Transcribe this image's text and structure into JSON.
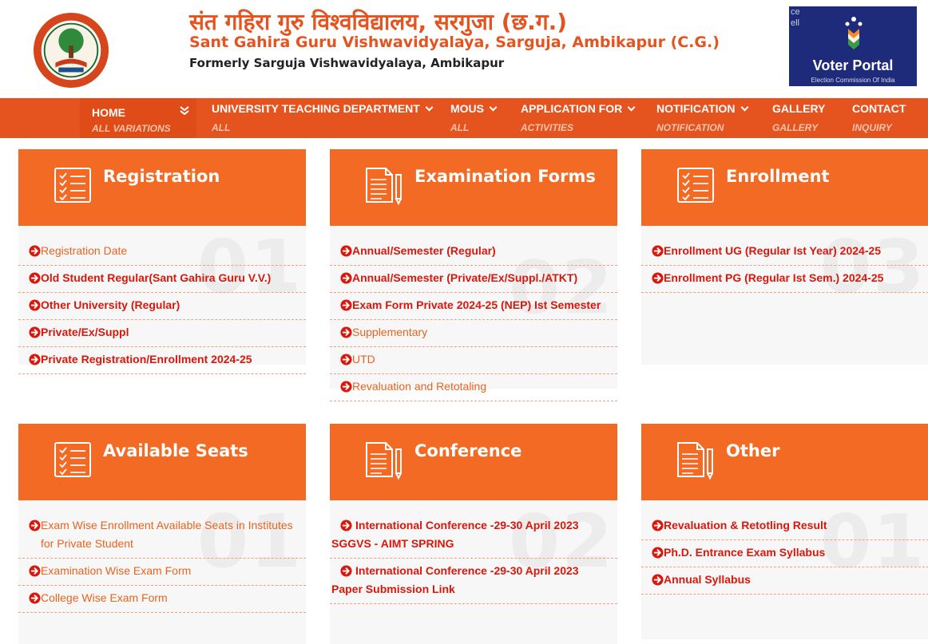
{
  "header": {
    "title_hindi": "संत गहिरा गुरु विश्वविद्यालय, सरगुजा (छ.ग.)",
    "title_english": "Sant Gahira Guru Vishwavidyalaya, Sarguja, Ambikapur (C.G.)",
    "subtitle": "Formerly Sarguja Vishwavidyalaya, Ambikapur",
    "voter_portal": {
      "alt_text": "ce ell",
      "title": "Voter Portal",
      "subtitle": "Election Commission Of India"
    }
  },
  "nav": [
    {
      "label": "HOME",
      "sub": "ALL VARIATIONS"
    },
    {
      "label": "UNIVERSITY TEACHING DEPARTMENT",
      "sub": "ALL"
    },
    {
      "label": "MOUS",
      "sub": "ALL"
    },
    {
      "label": "APPLICATION FOR",
      "sub": "ACTIVITIES"
    },
    {
      "label": "NOTIFICATION",
      "sub": "NOTIFICATION"
    },
    {
      "label": "GALLERY",
      "sub": "GALLERY"
    },
    {
      "label": "CONTACT",
      "sub": "INQUIRY"
    }
  ],
  "cards": [
    {
      "title": "Registration",
      "number": "01",
      "items": [
        "Registration Date",
        "Old Student Regular(Sant Gahira Guru V.V.)",
        "Other University (Regular)",
        "Private/Ex/Suppl",
        "Private Registration/Enrollment 2024-25"
      ]
    },
    {
      "title": "Examination Forms",
      "number": "02",
      "items": [
        "Annual/Semester (Regular)",
        "Annual/Semester (Private/Ex/Suppl./ATKT)",
        "Exam Form Private 2024-25 (NEP) Ist Semester",
        "Supplementary",
        "UTD",
        "Revaluation and Retotaling"
      ]
    },
    {
      "title": "Enrollment",
      "number": "03",
      "items": [
        "Enrollment UG (Regular Ist Year) 2024-25",
        "Enrollment PG (Regular Ist Sem.) 2024-25"
      ]
    },
    {
      "title": "Available Seats",
      "number": "01",
      "items": [
        "Exam Wise Enrollment Available Seats in Institutes for Private Student",
        "Examination Wise Exam Form",
        "College Wise Exam Form"
      ]
    },
    {
      "title": "Conference",
      "number": "02",
      "items": [
        "International Conference -29-30 April 2023 SGGVS - AIMT SPRING",
        "International Conference -29-30 April 2023 Paper Submission Link"
      ]
    },
    {
      "title": "Other",
      "number": "01",
      "items": [
        "Revaluation & Retotling Result",
        "Ph.D. Entrance Exam Syllabus",
        "Annual Syllabus"
      ]
    }
  ],
  "colors": {
    "brand_orange": "#e5541f",
    "card_header": "#f26a23",
    "link_red": "#d9170b",
    "link_orange": "#e7641f"
  }
}
